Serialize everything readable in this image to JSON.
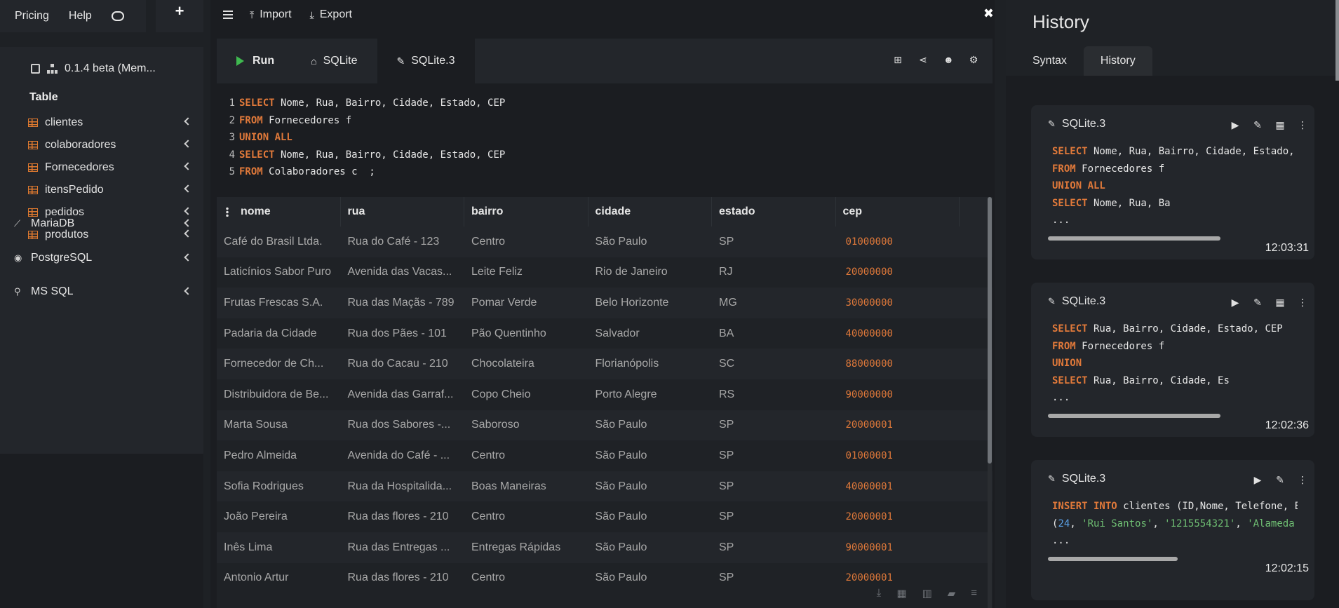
{
  "topnav": {
    "pricing": "Pricing",
    "help": "Help",
    "plus": "+"
  },
  "sidebar": {
    "db_title": "0.1.4 beta (Mem...",
    "table_label": "Table",
    "tables": [
      "clientes",
      "colaboradores",
      "Fornecedores",
      "itensPedido",
      "pedidos",
      "produtos"
    ],
    "groups": [
      "MariaDB",
      "PostgreSQL",
      "MS SQL"
    ]
  },
  "toolbar": {
    "import": "Import",
    "export": "Export",
    "close": "✖"
  },
  "tabs": {
    "run": "Run",
    "sqlite": "SQLite",
    "sqlite3": "SQLite.3"
  },
  "editor": {
    "lines": [
      {
        "n": "1",
        "kw": "SELECT",
        "rest": " Nome, Rua, Bairro, Cidade, Estado, CEP"
      },
      {
        "n": "2",
        "kw": "FROM",
        "rest": " Fornecedores f"
      },
      {
        "n": "3",
        "kw": "UNION ALL",
        "rest": ""
      },
      {
        "n": "4",
        "kw": "SELECT",
        "rest": " Nome, Rua, Bairro, Cidade, Estado, CEP"
      },
      {
        "n": "5",
        "kw": "FROM",
        "rest": " Colaboradores c  ;"
      }
    ]
  },
  "grid": {
    "columns": [
      "nome",
      "rua",
      "bairro",
      "cidade",
      "estado",
      "cep"
    ],
    "rows": [
      [
        "Café do Brasil Ltda.",
        "Rua do Café - 123",
        "Centro",
        "São Paulo",
        "SP",
        "01000000"
      ],
      [
        "Laticínios Sabor Puro",
        "Avenida das Vacas...",
        "Leite Feliz",
        "Rio de Janeiro",
        "RJ",
        "20000000"
      ],
      [
        "Frutas Frescas S.A.",
        "Rua das Maçãs - 789",
        "Pomar Verde",
        "Belo Horizonte",
        "MG",
        "30000000"
      ],
      [
        "Padaria da Cidade",
        "Rua dos Pães - 101",
        "Pão Quentinho",
        "Salvador",
        "BA",
        "40000000"
      ],
      [
        "Fornecedor de Ch...",
        "Rua do Cacau - 210",
        "Chocolateira",
        "Florianópolis",
        "SC",
        "88000000"
      ],
      [
        "Distribuidora de Be...",
        "Avenida das Garraf...",
        "Copo Cheio",
        "Porto Alegre",
        "RS",
        "90000000"
      ],
      [
        "Marta Sousa",
        "Rua dos Sabores -...",
        "Saboroso",
        "São Paulo",
        "SP",
        "20000001"
      ],
      [
        "Pedro Almeida",
        "Avenida do Café - ...",
        "Centro",
        "São Paulo",
        "SP",
        "01000001"
      ],
      [
        "Sofia Rodrigues",
        "Rua da Hospitalida...",
        "Boas Maneiras",
        "São Paulo",
        "SP",
        "40000001"
      ],
      [
        "João Pereira",
        "Rua das flores - 210",
        "Centro",
        "São Paulo",
        "SP",
        "20000001"
      ],
      [
        "Inês Lima",
        "Rua das Entregas ...",
        "Entregas Rápidas",
        "São Paulo",
        "SP",
        "90000001"
      ],
      [
        "Antonio Artur",
        "Rua das flores - 210",
        "Centro",
        "São Paulo",
        "SP",
        "20000001"
      ]
    ]
  },
  "history": {
    "title": "History",
    "tab_syntax": "Syntax",
    "tab_history": "History",
    "cards": [
      {
        "name": "SQLite.3",
        "time": "12:03:31",
        "scroll_fraction": 0.88,
        "lines": [
          [
            {
              "t": "kw",
              "v": "SELECT"
            },
            {
              "t": "tx",
              "v": " Nome, Rua, Bairro, Cidade, Estado, CEP"
            }
          ],
          [
            {
              "t": "kw",
              "v": "FROM"
            },
            {
              "t": "tx",
              "v": " Fornecedores f"
            }
          ],
          [
            {
              "t": "kw",
              "v": "UNION ALL"
            }
          ],
          [
            {
              "t": "kw",
              "v": "SELECT"
            },
            {
              "t": "tx",
              "v": " Nome, Rua, Ba"
            }
          ],
          [
            {
              "t": "tx",
              "v": "..."
            }
          ]
        ]
      },
      {
        "name": "SQLite.3",
        "time": "12:02:36",
        "scroll_fraction": 0.88,
        "lines": [
          [
            {
              "t": "kw",
              "v": "SELECT"
            },
            {
              "t": "tx",
              "v": " Rua, Bairro, Cidade, Estado, CEP"
            }
          ],
          [
            {
              "t": "kw",
              "v": "FROM"
            },
            {
              "t": "tx",
              "v": " Fornecedores f"
            }
          ],
          [
            {
              "t": "kw",
              "v": "UNION"
            }
          ],
          [
            {
              "t": "kw",
              "v": "SELECT"
            },
            {
              "t": "tx",
              "v": " Rua, Bairro, Cidade, Es"
            }
          ],
          [
            {
              "t": "tx",
              "v": "..."
            }
          ]
        ]
      },
      {
        "name": "SQLite.3",
        "time": "12:02:15",
        "scroll_fraction": 0.66,
        "lines": [
          [
            {
              "t": "kw",
              "v": "INSERT INTO"
            },
            {
              "t": "tx",
              "v": " clientes (ID,Nome, Telefone, Endereco)"
            }
          ],
          [
            {
              "t": "tx",
              "v": "("
            },
            {
              "t": "num",
              "v": "24"
            },
            {
              "t": "tx",
              "v": ", "
            },
            {
              "t": "str",
              "v": "'Rui Santos'"
            },
            {
              "t": "tx",
              "v": ", "
            },
            {
              "t": "str",
              "v": "'1215554321'"
            },
            {
              "t": "tx",
              "v": ", "
            },
            {
              "t": "str",
              "v": "'Alameda"
            }
          ],
          [
            {
              "t": "tx",
              "v": "..."
            }
          ]
        ]
      }
    ]
  }
}
